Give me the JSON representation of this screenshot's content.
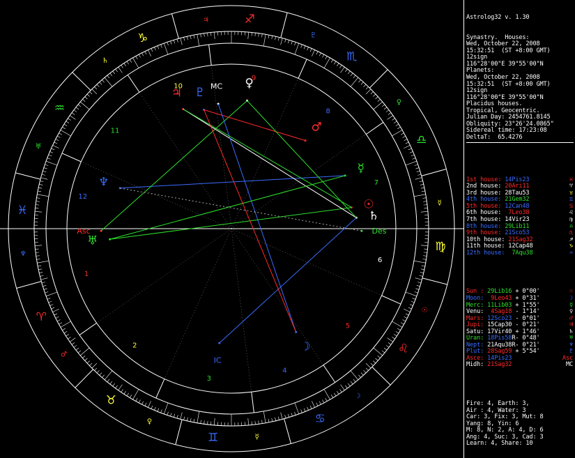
{
  "app": {
    "title": "Astrolog32 v. 1.30"
  },
  "header_lines": [
    "Synastry.  Houses:",
    "Wed, October 22, 2008",
    "15:32:51  (ST +8:00 GMT)",
    "12sign",
    "116°28'00\"E 39°55'00\"N",
    "Planets:",
    "Wed, October 22, 2008",
    "15:32:51  (ST +8:00 GMT)",
    "12sign",
    "116°28'00\"E 39°55'00\"N",
    "Placidus houses.",
    "Tropical, Geocentric.",
    "Julian Day: 2454761.8145",
    "Obliquity: 23°26'24.0865\"",
    "Sidereal time: 17:23:08",
    "DeltaT:  65.4276"
  ],
  "houses": [
    {
      "label": "1st house:",
      "value": "14Pis23",
      "glyph": "♓",
      "color": "#ff2a2a",
      "vcolor": "#3a6cff",
      "gcolor": "#ff2a2a"
    },
    {
      "label": "2nd house:",
      "value": "20Ari11",
      "glyph": "♈",
      "color": "#ffffff",
      "vcolor": "#ff2a2a",
      "gcolor": "#ffffff"
    },
    {
      "label": "3rd house:",
      "value": "28Tau53",
      "glyph": "♉",
      "color": "#ffffff",
      "vcolor": "#ffffff",
      "gcolor": "#ffff33"
    },
    {
      "label": "4th house:",
      "value": "21Gem32",
      "glyph": "♊",
      "color": "#3a6cff",
      "vcolor": "#2ee02e",
      "gcolor": "#3a6cff"
    },
    {
      "label": "5th house:",
      "value": "12Can48",
      "glyph": "♋",
      "color": "#ff2a2a",
      "vcolor": "#3a6cff",
      "gcolor": "#ff2a2a"
    },
    {
      "label": "6th house:",
      "value": " 7Leo38",
      "glyph": "♌",
      "color": "#ffffff",
      "vcolor": "#ff2a2a",
      "gcolor": "#ffffff"
    },
    {
      "label": "7th house:",
      "value": "14Vir23",
      "glyph": "♍",
      "color": "#ffffff",
      "vcolor": "#ffffff",
      "gcolor": "#ffffff"
    },
    {
      "label": "8th house:",
      "value": "29Lib11",
      "glyph": "♎",
      "color": "#3a6cff",
      "vcolor": "#2ee02e",
      "gcolor": "#2ee02e"
    },
    {
      "label": "9th house:",
      "value": "21Sco53",
      "glyph": "♏",
      "color": "#ff2a2a",
      "vcolor": "#3a6cff",
      "gcolor": "#ff2a2a"
    },
    {
      "label": "10th house:",
      "value": "21Sag32",
      "glyph": "♐",
      "color": "#ffffff",
      "vcolor": "#ff2a2a",
      "gcolor": "#ffffff"
    },
    {
      "label": "11th house:",
      "value": "12Cap48",
      "glyph": "♑",
      "color": "#ffffff",
      "vcolor": "#ffffff",
      "gcolor": "#ffff33"
    },
    {
      "label": "12th house:",
      "value": " 7Aqu38",
      "glyph": "♒",
      "color": "#3a6cff",
      "vcolor": "#2ee02e",
      "gcolor": "#3a6cff"
    }
  ],
  "planets": [
    {
      "name": "Sun :",
      "pos": "29Lib16",
      "lat": "+ 0°00'",
      "retro": " ",
      "glyph": "☉",
      "color": "#ff2a2a",
      "vcolor": "#2ee02e"
    },
    {
      "name": "Moon:",
      "pos": " 9Leo43",
      "lat": "+ 0°31'",
      "retro": " ",
      "glyph": "☽",
      "color": "#3a6cff",
      "vcolor": "#ff2a2a"
    },
    {
      "name": "Merc:",
      "pos": "11Lib03",
      "lat": "+ 1°55'",
      "retro": " ",
      "glyph": "☿",
      "color": "#2ee02e",
      "vcolor": "#2ee02e"
    },
    {
      "name": "Venu:",
      "pos": " 4Sag18",
      "lat": "- 1°14'",
      "retro": " ",
      "glyph": "♀",
      "color": "#ffffff",
      "vcolor": "#ff2a2a"
    },
    {
      "name": "Mars:",
      "pos": "12Sco23",
      "lat": "- 0°01'",
      "retro": " ",
      "glyph": "♂",
      "color": "#ff2a2a",
      "vcolor": "#3a6cff"
    },
    {
      "name": "Jupi:",
      "pos": "15Cap30",
      "lat": "- 0°21'",
      "retro": " ",
      "glyph": "♃",
      "color": "#ff2a2a",
      "vcolor": "#ffffff"
    },
    {
      "name": "Satu:",
      "pos": "17Vir40",
      "lat": "+ 1°46'",
      "retro": " ",
      "glyph": "♄",
      "color": "#ffffff",
      "vcolor": "#ffffff"
    },
    {
      "name": "Uran:",
      "pos": "18Pis58",
      "lat": "- 0°48'",
      "retro": "R",
      "glyph": "♅",
      "color": "#2ee02e",
      "vcolor": "#3a6cff"
    },
    {
      "name": "Nept:",
      "pos": "21Aqu38",
      "lat": "- 0°21'",
      "retro": "R",
      "glyph": "♆",
      "color": "#3a6cff",
      "vcolor": "#ffffff"
    },
    {
      "name": "Plut:",
      "pos": "28Sag59",
      "lat": "+ 5°54'",
      "retro": " ",
      "glyph": "♇",
      "color": "#3a6cff",
      "vcolor": "#ff2a2a"
    },
    {
      "name": "Asce:",
      "pos": "14Pis23",
      "lat": "",
      "retro": " ",
      "glyph": "Asc",
      "color": "#ff2a2a",
      "vcolor": "#3a6cff"
    },
    {
      "name": "Midh:",
      "pos": "21Sag32",
      "lat": "",
      "retro": " ",
      "glyph": "MC",
      "color": "#ffffff",
      "vcolor": "#ff2a2a"
    }
  ],
  "summary": [
    "Fire: 4, Earth: 3,",
    "Air : 4, Water: 3",
    "Car: 3, Fix: 3, Mut: 8",
    "Yang: 8, Yin: 6",
    "M: 8, N: 2, A: 4, D: 6",
    "Ang: 4, Suc: 3, Cad: 3",
    "Learn: 4, Share: 10"
  ],
  "wheel": {
    "signs": [
      {
        "glyph": "♐",
        "color": "#ff2a2a"
      },
      {
        "glyph": "♑",
        "color": "#ffff33"
      },
      {
        "glyph": "♒",
        "color": "#2ee02e"
      },
      {
        "glyph": "♓",
        "color": "#3a6cff"
      },
      {
        "glyph": "♈",
        "color": "#ff2a2a"
      },
      {
        "glyph": "♉",
        "color": "#ffff33"
      },
      {
        "glyph": "♊",
        "color": "#3a6cff"
      },
      {
        "glyph": "♋",
        "color": "#3a6cff"
      },
      {
        "glyph": "♌",
        "color": "#ff2a2a"
      },
      {
        "glyph": "♍",
        "color": "#ffff33"
      },
      {
        "glyph": "♎",
        "color": "#2ee02e"
      },
      {
        "glyph": "♏",
        "color": "#3a6cff"
      }
    ],
    "rulers": [
      {
        "glyph": "♃",
        "color": "#ff2a2a"
      },
      {
        "glyph": "♄",
        "color": "#ffff33"
      },
      {
        "glyph": "♅",
        "color": "#2ee02e"
      },
      {
        "glyph": "♆",
        "color": "#3a6cff"
      },
      {
        "glyph": "♂",
        "color": "#ff2a2a"
      },
      {
        "glyph": "♀",
        "color": "#ffff33"
      },
      {
        "glyph": "☿",
        "color": "#ffff33"
      },
      {
        "glyph": "☽",
        "color": "#3a6cff"
      },
      {
        "glyph": "☉",
        "color": "#ff2a2a"
      },
      {
        "glyph": "☿",
        "color": "#ffff33"
      },
      {
        "glyph": "♀",
        "color": "#2ee02e"
      },
      {
        "glyph": "♇",
        "color": "#3a6cff"
      }
    ],
    "house_numbers": [
      {
        "num": "1",
        "color": "#ff2a2a"
      },
      {
        "num": "2",
        "color": "#ffff33"
      },
      {
        "num": "3",
        "color": "#2ee02e"
      },
      {
        "num": "4",
        "color": "#3a6cff"
      },
      {
        "num": "5",
        "color": "#ff2a2a"
      },
      {
        "num": "6",
        "color": "#ffffff"
      },
      {
        "num": "7",
        "color": "#2ee02e"
      },
      {
        "num": "8",
        "color": "#3a6cff"
      },
      {
        "num": "9",
        "color": "#ff2a2a"
      },
      {
        "num": "10",
        "color": "#ffff33"
      },
      {
        "num": "11",
        "color": "#2ee02e"
      },
      {
        "num": "12",
        "color": "#3a6cff"
      }
    ],
    "planet_glyphs": [
      {
        "glyph": "☉",
        "color": "#ff2a2a"
      },
      {
        "glyph": "☽",
        "color": "#3a6cff"
      },
      {
        "glyph": "☿",
        "color": "#2ee02e"
      },
      {
        "glyph": "♀",
        "color": "#ffffff"
      },
      {
        "glyph": "♂",
        "color": "#ff2a2a"
      },
      {
        "glyph": "♃",
        "color": "#ff2a2a"
      },
      {
        "glyph": "♄",
        "color": "#ffffff"
      },
      {
        "glyph": "♅",
        "color": "#2ee02e"
      },
      {
        "glyph": "♆",
        "color": "#3a6cff"
      },
      {
        "glyph": "♇",
        "color": "#3a6cff"
      },
      {
        "glyph": "Asc",
        "color": "#ff2a2a"
      },
      {
        "glyph": "MC",
        "color": "#ffffff"
      },
      {
        "glyph": "Des",
        "color": "#2ee02e"
      },
      {
        "glyph": "IC",
        "color": "#3a6cff"
      }
    ]
  }
}
